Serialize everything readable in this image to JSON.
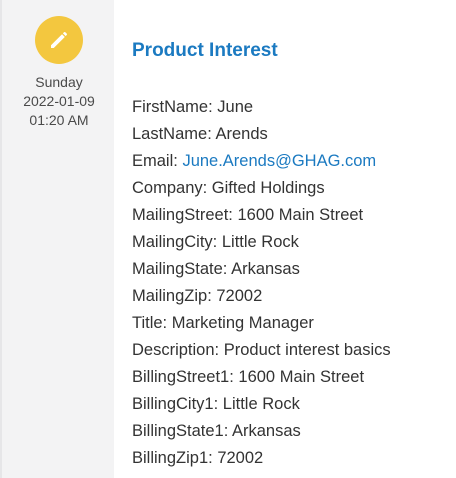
{
  "activity": {
    "icon": "pencil-icon",
    "icon_color": "#f3c73f",
    "day": "Sunday",
    "date": "2022-01-09",
    "time": "01:20 AM"
  },
  "record": {
    "title": "Product Interest",
    "title_color": "#1b7ac1",
    "fields": [
      {
        "label": "FirstName:",
        "value": "June"
      },
      {
        "label": "LastName:",
        "value": "Arends"
      },
      {
        "label": "Email:",
        "value": "June.Arends@GHAG.com",
        "is_link": true
      },
      {
        "label": "Company:",
        "value": "Gifted Holdings"
      },
      {
        "label": "MailingStreet:",
        "value": "1600 Main Street"
      },
      {
        "label": "MailingCity:",
        "value": "Little Rock"
      },
      {
        "label": "MailingState:",
        "value": "Arkansas"
      },
      {
        "label": "MailingZip:",
        "value": "72002"
      },
      {
        "label": "Title:",
        "value": "Marketing Manager"
      },
      {
        "label": "Description:",
        "value": "Product interest basics"
      },
      {
        "label": "BillingStreet1:",
        "value": "1600 Main Street"
      },
      {
        "label": "BillingCity1:",
        "value": "Little Rock"
      },
      {
        "label": "BillingState1:",
        "value": "Arkansas"
      },
      {
        "label": "BillingZip1:",
        "value": "72002"
      }
    ]
  }
}
